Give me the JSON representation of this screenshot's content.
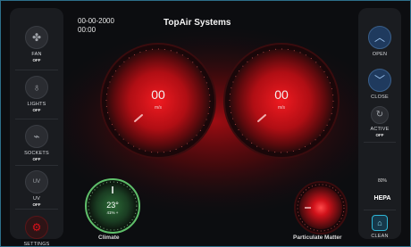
{
  "header": {
    "date": "00-00-2000",
    "time": "00:00",
    "brand": "TopAir Systems"
  },
  "left_controls": [
    {
      "label": "FAN",
      "state": "OFF",
      "icon": "fan-icon"
    },
    {
      "label": "LIGHTS",
      "state": "OFF",
      "icon": "bulb-icon"
    },
    {
      "label": "SOCKETS",
      "state": "OFF",
      "icon": "plug-icon"
    },
    {
      "label": "UV",
      "state": "OFF",
      "icon": "uv-icon",
      "icon_text": "UV"
    },
    {
      "label": "SETTINGS",
      "icon": "gear-icon"
    }
  ],
  "right_controls": {
    "open_label": "OPEN",
    "close_label": "CLOSE",
    "active_label": "ACTIVE",
    "active_state": "OFF",
    "hepa_percent": "80%",
    "hepa_label": "HEPA",
    "clean_label": "CLEAN"
  },
  "gauges": {
    "left": {
      "value": "00",
      "unit": "m/s"
    },
    "right": {
      "value": "00",
      "unit": "m/s"
    }
  },
  "climate": {
    "temperature": "23°",
    "humidity": "41% +",
    "label": "Climate"
  },
  "particulate": {
    "label": "Particulate Matter"
  },
  "colors": {
    "accent_red": "#e0101a",
    "climate_green": "#5fbf6a",
    "frame_blue": "#2d6f8a",
    "hepa_blue": "#2fb6d6"
  }
}
